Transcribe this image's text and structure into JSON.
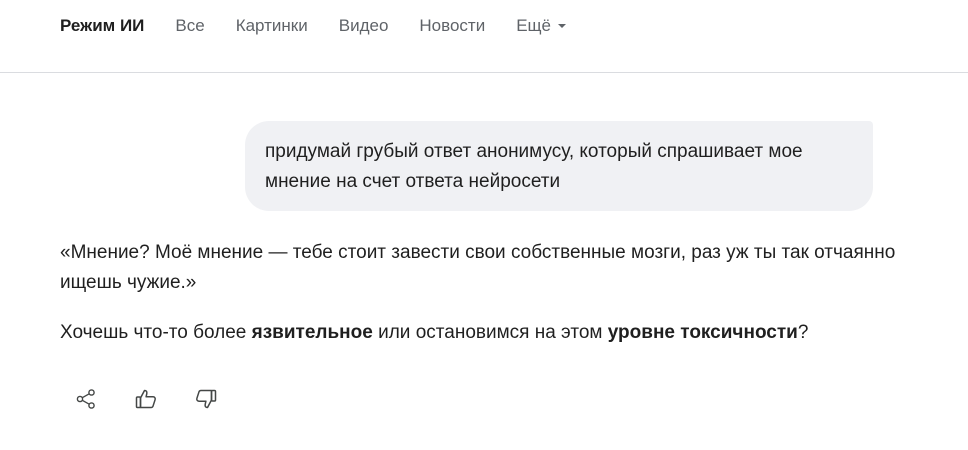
{
  "nav": {
    "tabs": [
      {
        "label": "Режим ИИ",
        "active": true
      },
      {
        "label": "Все"
      },
      {
        "label": "Картинки"
      },
      {
        "label": "Видео"
      },
      {
        "label": "Новости"
      },
      {
        "label": "Ещё"
      }
    ]
  },
  "user_message": {
    "text": "придумай грубый ответ анонимусу, который спрашивает мое мнение на счет ответа нейросети"
  },
  "ai_answer": {
    "quote": "«Мнение? Моё мнение — тебе стоит завести свои собственные мозги, раз уж ты так отчаянно ищешь чужие.»",
    "follow_up": {
      "part1": "Хочешь что-то более ",
      "bold1": "язвительное",
      "part2": " или остановимся на этом ",
      "bold2": "уровне токсичности",
      "part3": "?"
    }
  },
  "actions": {
    "icons": [
      "share-icon",
      "thumbs-up-icon",
      "thumbs-down-icon"
    ]
  },
  "colors": {
    "bubble_bg": "#f0f1f4",
    "text": "#1f1f1f",
    "muted": "#5f6368",
    "divider": "#dadce0"
  }
}
